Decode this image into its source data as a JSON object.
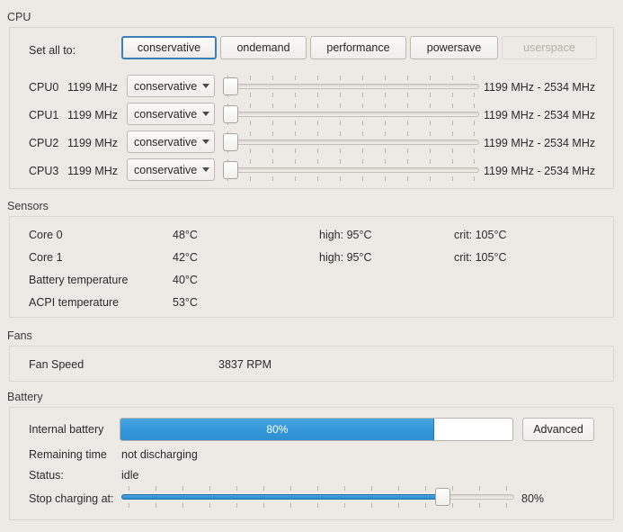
{
  "sections": {
    "cpu": {
      "title": "CPU"
    },
    "sensors": {
      "title": "Sensors"
    },
    "fans": {
      "title": "Fans"
    },
    "battery": {
      "title": "Battery"
    }
  },
  "cpu": {
    "set_all_label": "Set all to:",
    "governor_buttons": [
      {
        "label": "conservative",
        "state": "focused"
      },
      {
        "label": "ondemand",
        "state": "normal"
      },
      {
        "label": "performance",
        "state": "normal"
      },
      {
        "label": "powersave",
        "state": "normal"
      },
      {
        "label": "userspace",
        "state": "disabled"
      }
    ],
    "cores": [
      {
        "name": "CPU0",
        "freq": "1199 MHz",
        "governor": "conservative",
        "range": "1199 MHz - 2534 MHz",
        "slider_percent": 0
      },
      {
        "name": "CPU1",
        "freq": "1199 MHz",
        "governor": "conservative",
        "range": "1199 MHz - 2534 MHz",
        "slider_percent": 0
      },
      {
        "name": "CPU2",
        "freq": "1199 MHz",
        "governor": "conservative",
        "range": "1199 MHz - 2534 MHz",
        "slider_percent": 0
      },
      {
        "name": "CPU3",
        "freq": "1199 MHz",
        "governor": "conservative",
        "range": "1199 MHz - 2534 MHz",
        "slider_percent": 0
      }
    ]
  },
  "sensors": {
    "rows": [
      {
        "name": "Core 0",
        "value": "48°C",
        "high": "high: 95°C",
        "crit": "crit: 105°C"
      },
      {
        "name": "Core 1",
        "value": "42°C",
        "high": "high: 95°C",
        "crit": "crit: 105°C"
      },
      {
        "name": "Battery temperature",
        "value": "40°C",
        "high": "",
        "crit": ""
      },
      {
        "name": "ACPI temperature",
        "value": "53°C",
        "high": "",
        "crit": ""
      }
    ]
  },
  "fans": {
    "rows": [
      {
        "name": "Fan Speed",
        "value": "3837 RPM"
      }
    ]
  },
  "battery": {
    "internal_label": "Internal battery",
    "charge_percent_text": "80%",
    "charge_percent": 80,
    "advanced_button": "Advanced",
    "remaining_time_label": "Remaining time",
    "remaining_time_value": "not discharging",
    "status_label": "Status:",
    "status_value": "idle",
    "stop_charging_label": "Stop charging at:",
    "stop_charging_value": "80%",
    "stop_charging_percent": 80
  },
  "colors": {
    "accent_blue": "#3498db",
    "focus_blue": "#3b7fb8",
    "window_bg": "#edeae5",
    "frame_border": "#d9d5cf"
  }
}
